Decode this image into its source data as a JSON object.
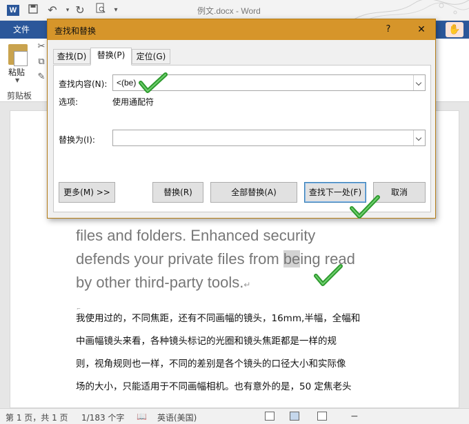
{
  "window": {
    "title": "例文.docx - Word",
    "app_icon": "W"
  },
  "ribbon": {
    "file_tab": "文件",
    "paste_label": "粘贴",
    "clipboard_label": "剪贴板"
  },
  "dialog": {
    "title": "查找和替换",
    "help": "?",
    "close": "✕",
    "tabs": [
      {
        "label": "查找(D)",
        "active": false
      },
      {
        "label": "替换(P)",
        "active": true
      },
      {
        "label": "定位(G)",
        "active": false
      }
    ],
    "find_label": "查找内容(N):",
    "find_value": "<(be)",
    "options_label": "选项:",
    "options_value": "使用通配符",
    "replace_label": "替换为(I):",
    "replace_value": "",
    "buttons": {
      "more": "更多(M) >>",
      "replace": "替换(R)",
      "replace_all": "全部替换(A)",
      "find_next": "查找下一处(F)",
      "cancel": "取消"
    }
  },
  "document": {
    "english_lines": [
      {
        "before": "files and folders. Enhanced security",
        "highlight": "",
        "after": ""
      },
      {
        "before": "defends your private files from ",
        "highlight": "be",
        "after": "ing read"
      },
      {
        "before": "by other third-party tools.",
        "highlight": "",
        "after": ""
      }
    ],
    "paragraph_mark": "↵",
    "chinese_lines": [
      "我使用过的，不同焦距，还有不同画幅的镜头，16mm,半幅，全幅和",
      "中画幅镜头来看，各种镜头标记的光圈和镜头焦距都是一样的规",
      "则，视角规则也一样，不同的差别是各个镜头的口径大小和实际像",
      "场的大小，只能适用于不同画幅相机。也有意外的是，50 定焦老头"
    ]
  },
  "status": {
    "page": "第 1 页，共 1 页",
    "words": "1/183 个字",
    "language": "英语(美国)"
  },
  "colors": {
    "accent": "#2b579a",
    "dialog_title": "#d6952a",
    "check": "#2e9a2e"
  }
}
